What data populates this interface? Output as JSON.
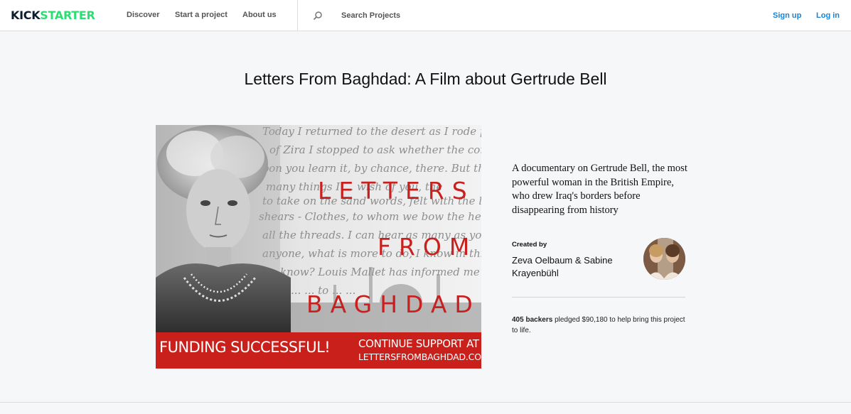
{
  "nav": {
    "logo_part1": "KICK",
    "logo_part2": "STARTER",
    "discover": "Discover",
    "start_project": "Start a project",
    "about_us": "About us",
    "search_placeholder": "Search Projects",
    "sign_up": "Sign up",
    "log_in": "Log in",
    "accent_color": "#1a82d4",
    "brand_green": "#2bde73"
  },
  "project": {
    "title": "Letters From Baghdad: A Film about Gertrude Bell",
    "blurb": "A documentary on Gertrude Bell, the most powerful woman in the British Empire, who drew Iraq's borders before disappearing from history",
    "created_by_label": "Created by",
    "creator_name": "Zeva Oelbaum & Sabine Krayenbühl",
    "backers": "405 backers",
    "pledged_text": "pledged $90,180 to help bring this project to life."
  },
  "hero": {
    "word1": "LETTERS",
    "word2": "FROM",
    "word3": "BAGHDAD",
    "banner_left": "FUNDING SUCCESSFUL!",
    "banner_right1": "CONTINUE SUPPORT AT",
    "banner_right2": "LETTERSFROMBAGHDAD.COM",
    "red_color": "#c9201c",
    "handwriting_lines": [
      "Today I returned to the desert as I rode past the",
      "of Zira I stopped to ask whether the commis",
      "upon you learn it, by chance, there. But there",
      "many things I ... wish of you, the",
      "to take on the sand words, felt with the light",
      "shears - Clothes, to whom we bow the heads. I ha",
      "all the threads. I can hear as many as you go on",
      "anyone, what is more to do, I know in this",
      "know? Louis Mallet has informed me the",
      "... ... to ... ..."
    ]
  }
}
